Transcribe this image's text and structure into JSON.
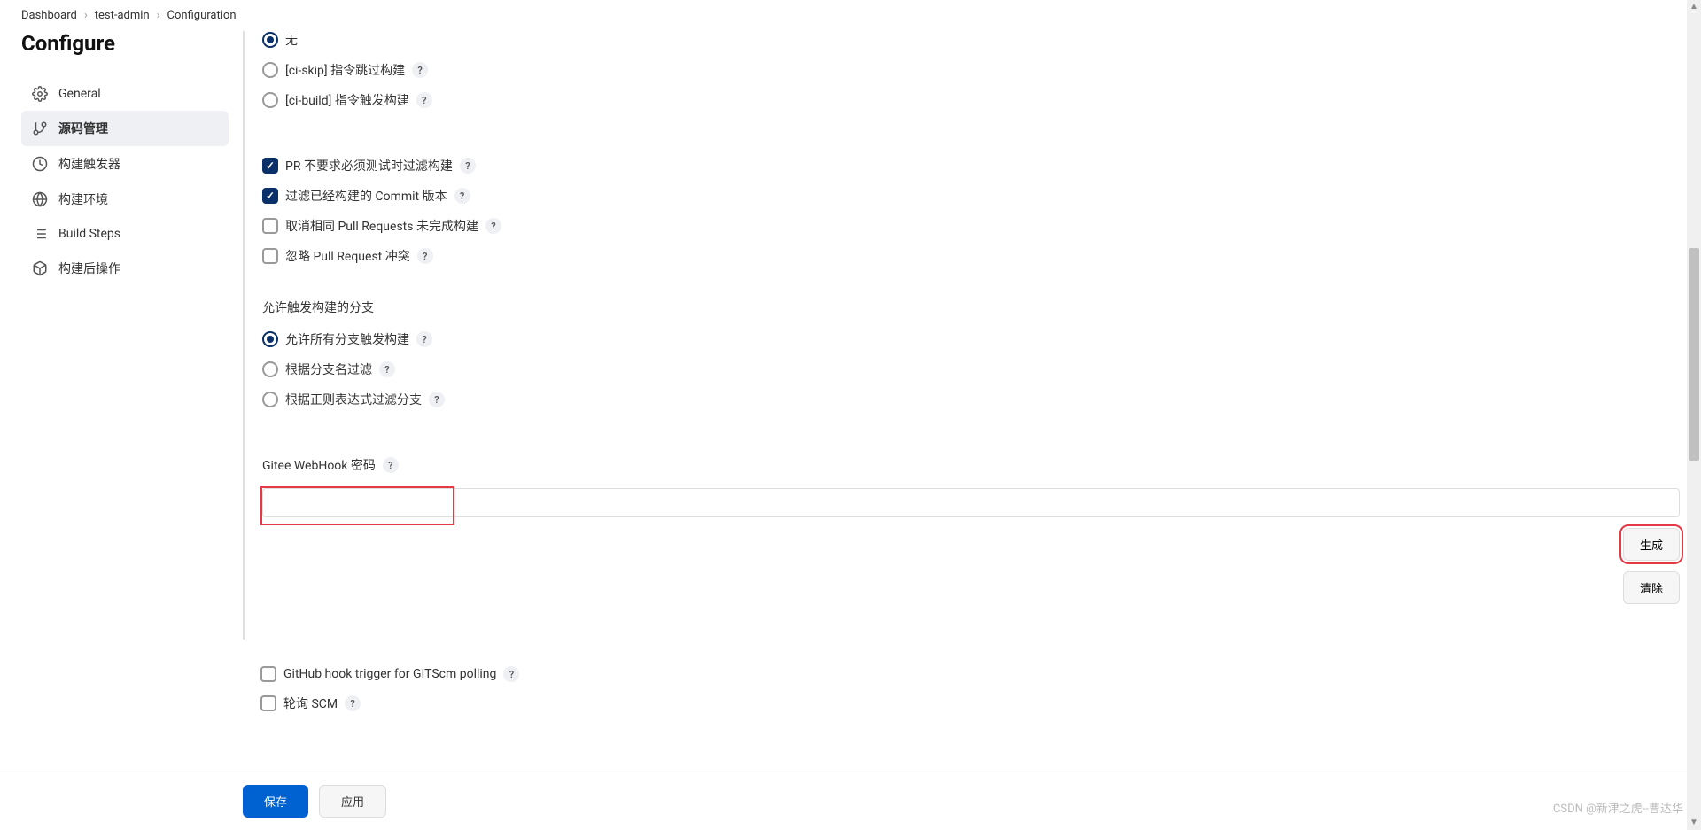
{
  "breadcrumb": {
    "items": [
      "Dashboard",
      "test-admin",
      "Configuration"
    ]
  },
  "sidebar": {
    "title": "Configure",
    "items": [
      {
        "label": "General",
        "icon": "gear"
      },
      {
        "label": "源码管理",
        "icon": "branch"
      },
      {
        "label": "构建触发器",
        "icon": "clock"
      },
      {
        "label": "构建环境",
        "icon": "globe"
      },
      {
        "label": "Build Steps",
        "icon": "steps"
      },
      {
        "label": "构建后操作",
        "icon": "package"
      }
    ]
  },
  "form": {
    "skipGroup": {
      "none": "无",
      "ciSkip": "[ci-skip] 指令跳过构建",
      "ciBuild": "[ci-build] 指令触发构建"
    },
    "checkboxes": {
      "prNoTest": "PR 不要求必须测试时过滤构建",
      "filterCommit": "过滤已经构建的 Commit 版本",
      "cancelSamePR": "取消相同 Pull Requests 未完成构建",
      "ignoreConflict": "忽略 Pull Request 冲突"
    },
    "branchSection": {
      "title": "允许触发构建的分支",
      "allowAll": "允许所有分支触发构建",
      "filterByName": "根据分支名过滤",
      "filterByRegex": "根据正则表达式过滤分支"
    },
    "webhook": {
      "label": "Gitee WebHook 密码",
      "value": "",
      "generateBtn": "生成",
      "clearBtn": "清除"
    },
    "bottom": {
      "githubHook": "GitHub hook trigger for GITScm polling",
      "pollSCM": "轮询 SCM"
    }
  },
  "footer": {
    "save": "保存",
    "apply": "应用"
  },
  "watermark": "CSDN @新津之虎--曹达华"
}
